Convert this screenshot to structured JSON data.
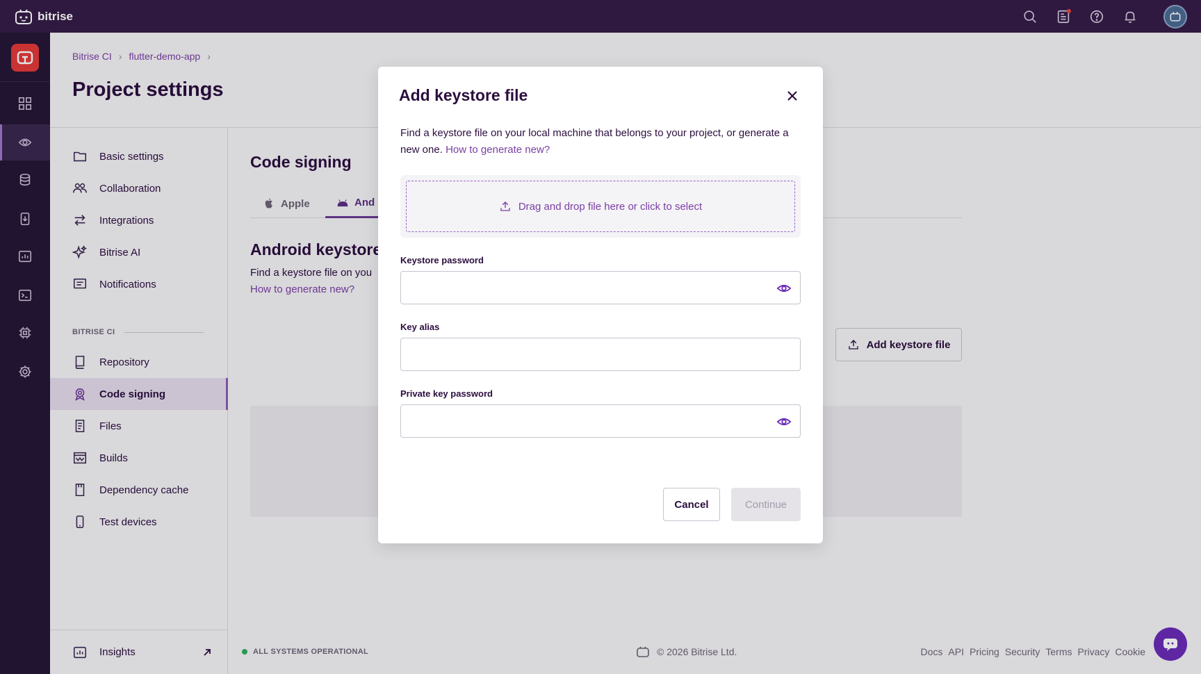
{
  "app": {
    "brand": "bitrise"
  },
  "breadcrumb": [
    "Bitrise CI",
    "flutter-demo-app"
  ],
  "page": {
    "title": "Project settings"
  },
  "settings_nav": {
    "items": [
      {
        "label": "Basic settings",
        "icon": "folder-icon"
      },
      {
        "label": "Collaboration",
        "icon": "users-icon"
      },
      {
        "label": "Integrations",
        "icon": "arrows-icon"
      },
      {
        "label": "Bitrise AI",
        "icon": "sparkle-icon"
      },
      {
        "label": "Notifications",
        "icon": "message-icon"
      }
    ],
    "section_label": "BITRISE CI",
    "ci_items": [
      {
        "label": "Repository",
        "icon": "repository-icon"
      },
      {
        "label": "Code signing",
        "icon": "badge-icon",
        "active": true
      },
      {
        "label": "Files",
        "icon": "file-icon"
      },
      {
        "label": "Builds",
        "icon": "builds-icon"
      },
      {
        "label": "Dependency cache",
        "icon": "cache-icon"
      },
      {
        "label": "Test devices",
        "icon": "phone-icon"
      }
    ],
    "insights_label": "Insights"
  },
  "content": {
    "title": "Code signing",
    "tabs": [
      {
        "label": "Apple",
        "icon": "apple-icon"
      },
      {
        "label": "And",
        "icon": "android-icon",
        "selected": true
      }
    ],
    "android_title": "Android keystore",
    "android_desc": "Find a keystore file on you",
    "android_link": "How to generate new?",
    "add_button": "Add keystore file"
  },
  "footer": {
    "status": "ALL SYSTEMS OPERATIONAL",
    "copyright": "© 2026 Bitrise Ltd.",
    "links": [
      "Docs",
      "API",
      "Pricing",
      "Security",
      "Terms",
      "Privacy",
      "Cookie"
    ]
  },
  "modal": {
    "title": "Add keystore file",
    "description": "Find a keystore file on your local machine that belongs to your project, or generate a new one.",
    "description_link": "How to generate new?",
    "dropzone_text": "Drag and drop file here or click to select",
    "fields": {
      "keystore_password_label": "Keystore password",
      "key_alias_label": "Key alias",
      "private_key_password_label": "Private key password"
    },
    "cancel_label": "Cancel",
    "continue_label": "Continue"
  },
  "colors": {
    "topbar": "#351d48",
    "rail": "#261736",
    "accent": "#7a3fa3",
    "status_ok": "#2fae5a"
  }
}
